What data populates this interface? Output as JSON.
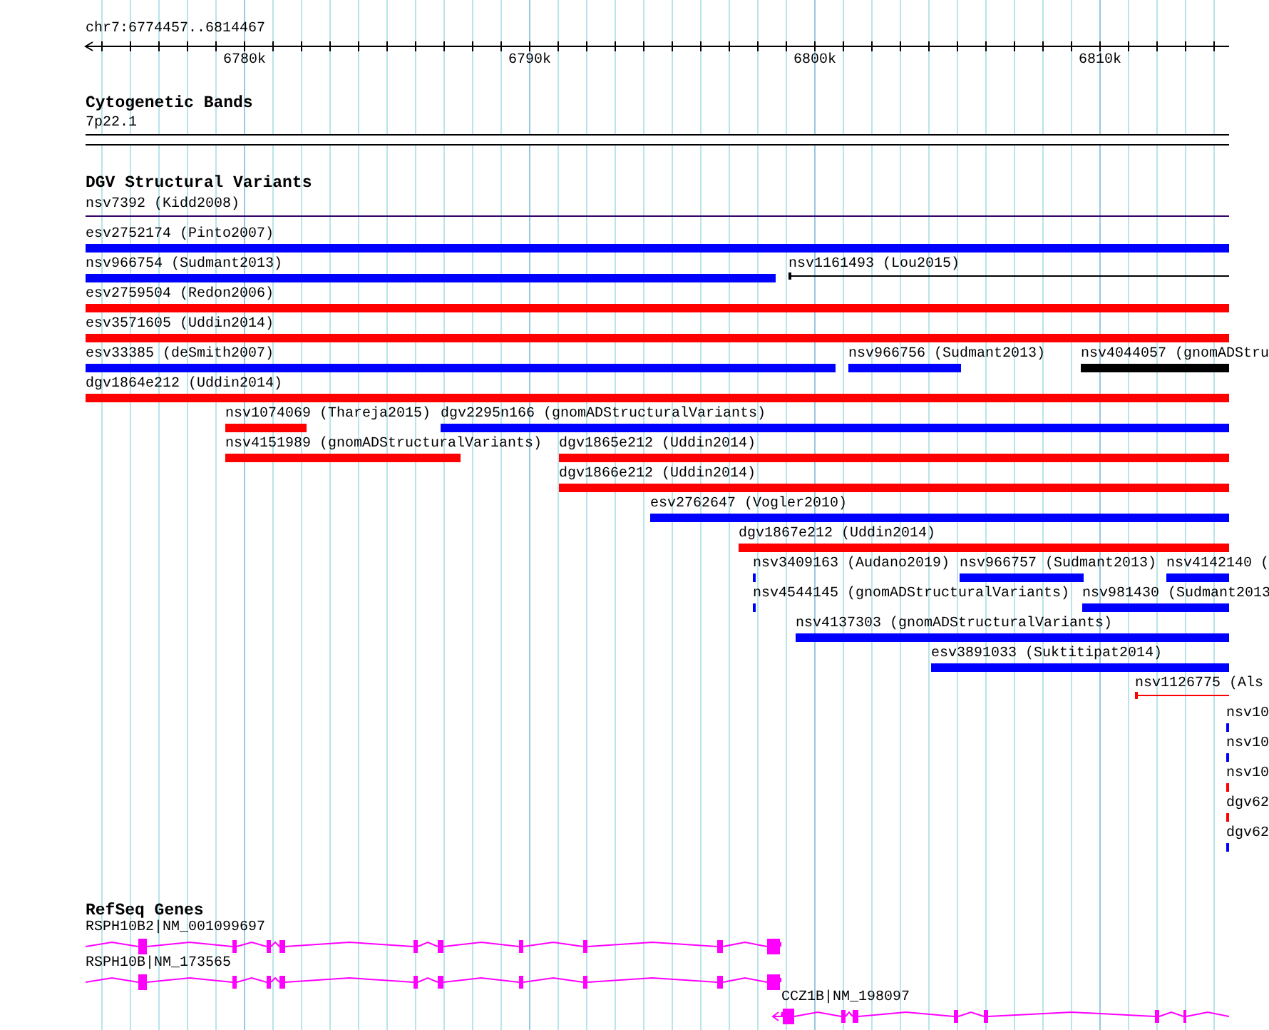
{
  "ruler": {
    "location": "chr7:6774457..6814467",
    "tick_labels": [
      "6780k",
      "6790k",
      "6800k",
      "6810k"
    ]
  },
  "tracks": [
    {
      "kind": "bands",
      "title": "Cytogenetic Bands",
      "features": [
        {
          "label": "7p22.1"
        }
      ]
    },
    {
      "kind": "variants",
      "title": "DGV Structural Variants",
      "rows": [
        [
          {
            "label": "nsv7392 (Kidd2008)",
            "kind": "line",
            "color": "#330066"
          }
        ],
        [
          {
            "label": "esv2752174 (Pinto2007)",
            "kind": "bar",
            "color": "#0000ff"
          }
        ],
        [
          {
            "label": "nsv966754 (Sudmant2013)",
            "kind": "bar",
            "color": "#0000ff"
          },
          {
            "label": "nsv1161493 (Lou2015)",
            "kind": "line",
            "color": "#000000"
          }
        ],
        [
          {
            "label": "esv2759504 (Redon2006)",
            "kind": "bar",
            "color": "#ff0000"
          }
        ],
        [
          {
            "label": "esv3571605 (Uddin2014)",
            "kind": "bar",
            "color": "#ff0000"
          }
        ],
        [
          {
            "label": "esv33385 (deSmith2007)",
            "kind": "bar",
            "color": "#0000ff"
          },
          {
            "label": "nsv966756 (Sudmant2013)",
            "kind": "bar",
            "color": "#0000ff"
          },
          {
            "label": "nsv4044057 (gnomADStru",
            "kind": "bar",
            "color": "#000000"
          }
        ],
        [
          {
            "label": "dgv1864e212 (Uddin2014)",
            "kind": "bar",
            "color": "#ff0000"
          }
        ],
        [
          {
            "label": "nsv1074069 (Thareja2015)",
            "kind": "bar",
            "color": "#ff0000"
          },
          {
            "label": "dgv2295n166 (gnomADStructuralVariants)",
            "kind": "bar",
            "color": "#0000ff"
          }
        ],
        [
          {
            "label": "nsv4151989 (gnomADStructuralVariants)",
            "kind": "bar",
            "color": "#ff0000"
          },
          {
            "label": "dgv1865e212 (Uddin2014)",
            "kind": "bar",
            "color": "#ff0000"
          }
        ],
        [
          {
            "label": "dgv1866e212 (Uddin2014)",
            "kind": "bar",
            "color": "#ff0000"
          }
        ],
        [
          {
            "label": "esv2762647 (Vogler2010)",
            "kind": "bar",
            "color": "#0000ff"
          }
        ],
        [
          {
            "label": "dgv1867e212 (Uddin2014)",
            "kind": "bar",
            "color": "#ff0000"
          }
        ],
        [
          {
            "label": "nsv3409163 (Audano2019)",
            "kind": "bar",
            "color": "#0000ff"
          },
          {
            "label": "nsv966757 (Sudmant2013)",
            "kind": "bar",
            "color": "#0000ff"
          },
          {
            "label": "nsv4142140 (",
            "kind": "bar",
            "color": "#0000ff"
          }
        ],
        [
          {
            "label": "nsv4544145 (gnomADStructuralVariants)",
            "kind": "bar",
            "color": "#0000ff"
          },
          {
            "label": "nsv981430 (Sudmant2013",
            "kind": "bar",
            "color": "#0000ff"
          }
        ],
        [
          {
            "label": "nsv4137303 (gnomADStructuralVariants)",
            "kind": "bar",
            "color": "#0000ff"
          }
        ],
        [
          {
            "label": "esv3891033 (Suktitipat2014)",
            "kind": "bar",
            "color": "#0000ff"
          }
        ],
        [
          {
            "label": "nsv1126775 (Als",
            "kind": "line",
            "color": "#ff0000"
          }
        ],
        [
          {
            "label": "nsv10",
            "kind": "bar",
            "color": "#0000ff"
          }
        ],
        [
          {
            "label": "nsv10",
            "kind": "bar",
            "color": "#0000ff"
          }
        ],
        [
          {
            "label": "nsv10",
            "kind": "bar",
            "color": "#ff0000"
          }
        ],
        [
          {
            "label": "dgv62",
            "kind": "bar",
            "color": "#ff0000"
          }
        ],
        [
          {
            "label": "dgv62",
            "kind": "bar",
            "color": "#0000ff"
          }
        ]
      ]
    },
    {
      "kind": "genes",
      "title": "RefSeq Genes",
      "genes": [
        {
          "label": "RSPH10B2|NM_001099697"
        },
        {
          "label": "RSPH10B|NM_173565"
        },
        {
          "label": "CCZ1B|NM_198097"
        }
      ]
    }
  ]
}
